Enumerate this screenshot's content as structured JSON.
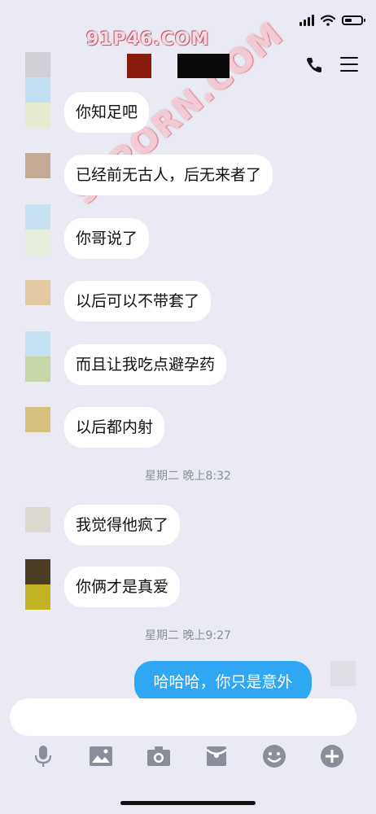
{
  "status_bar": {
    "icons": [
      "signal-icon",
      "wifi-icon",
      "battery-icon"
    ]
  },
  "watermarks": {
    "top": "91P46.COM",
    "diagonal": "91PORN.COM"
  },
  "header": {
    "icons": [
      "phone-icon",
      "menu-icon"
    ]
  },
  "messages": [
    {
      "text": "你知足吧"
    },
    {
      "text": "已经前无古人，后无来者了"
    },
    {
      "text": "你哥说了"
    },
    {
      "text": "以后可以不带套了"
    },
    {
      "text": "而且让我吃点避孕药"
    },
    {
      "text": "以后都内射"
    },
    {
      "text": "我觉得他疯了"
    },
    {
      "text": "你俩才是真爱"
    }
  ],
  "timestamps": [
    "星期二 晚上8:32",
    "星期二 晚上9:27"
  ],
  "outgoing": {
    "text": "哈哈哈，你只是意外"
  },
  "toolbar": {
    "icons": [
      "microphone-icon",
      "image-icon",
      "camera-icon",
      "red-packet-icon",
      "emoji-icon",
      "plus-icon"
    ]
  },
  "colors": {
    "background": "#e9eaf3",
    "bubble_in": "#ffffff",
    "bubble_out": "#2fa7f2",
    "icon_gray": "#8b8d98"
  }
}
